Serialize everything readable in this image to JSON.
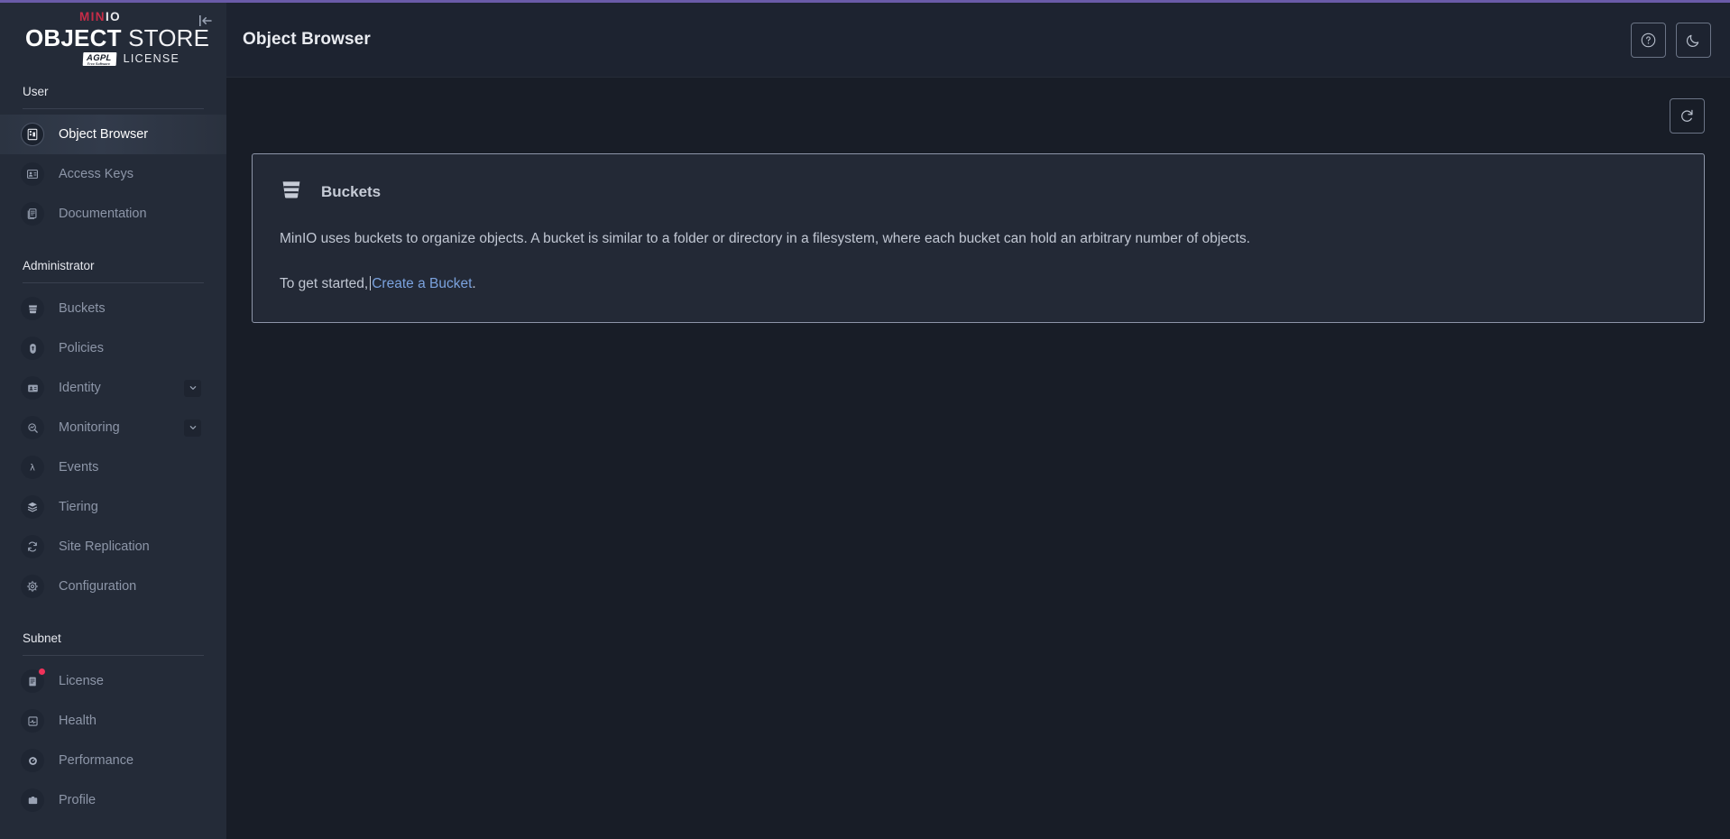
{
  "brand": {
    "name_top": "MIN",
    "name_top_io": "IO",
    "product_bold": "OBJECT",
    "product_light": "STORE",
    "agpl": "AGPL",
    "agpl_sub": "Free Software",
    "license_word": "LICENSE",
    "accent_color": "#c72c48",
    "top_accent_color": "#6a5ba8"
  },
  "sidebar": {
    "collapse_icon": "collapse-sidebar-icon",
    "sections": [
      {
        "title": "User",
        "items": [
          {
            "label": "Object Browser",
            "icon": "object-browser-icon",
            "active": true,
            "chevron": false,
            "badge": false
          },
          {
            "label": "Access Keys",
            "icon": "access-keys-icon",
            "active": false,
            "chevron": false,
            "badge": false
          },
          {
            "label": "Documentation",
            "icon": "documentation-icon",
            "active": false,
            "chevron": false,
            "badge": false
          }
        ]
      },
      {
        "title": "Administrator",
        "items": [
          {
            "label": "Buckets",
            "icon": "bucket-icon",
            "active": false,
            "chevron": false,
            "badge": false
          },
          {
            "label": "Policies",
            "icon": "policy-lock-icon",
            "active": false,
            "chevron": false,
            "badge": false
          },
          {
            "label": "Identity",
            "icon": "identity-card-icon",
            "active": false,
            "chevron": true,
            "badge": false
          },
          {
            "label": "Monitoring",
            "icon": "monitoring-icon",
            "active": false,
            "chevron": true,
            "badge": false
          },
          {
            "label": "Events",
            "icon": "lambda-events-icon",
            "active": false,
            "chevron": false,
            "badge": false
          },
          {
            "label": "Tiering",
            "icon": "tiering-layers-icon",
            "active": false,
            "chevron": false,
            "badge": false
          },
          {
            "label": "Site Replication",
            "icon": "site-replication-icon",
            "active": false,
            "chevron": false,
            "badge": false
          },
          {
            "label": "Configuration",
            "icon": "gear-icon",
            "active": false,
            "chevron": false,
            "badge": false
          }
        ]
      },
      {
        "title": "Subnet",
        "items": [
          {
            "label": "License",
            "icon": "license-icon",
            "active": false,
            "chevron": false,
            "badge": true
          },
          {
            "label": "Health",
            "icon": "health-icon",
            "active": false,
            "chevron": false,
            "badge": false
          },
          {
            "label": "Performance",
            "icon": "performance-icon",
            "active": false,
            "chevron": false,
            "badge": false
          },
          {
            "label": "Profile",
            "icon": "profile-icon",
            "active": false,
            "chevron": false,
            "badge": false
          }
        ]
      }
    ]
  },
  "header": {
    "title": "Object Browser",
    "help_button": "help-icon",
    "theme_button": "dark-mode-moon-icon"
  },
  "toolbar": {
    "refresh_button": "refresh-icon"
  },
  "card": {
    "icon": "bucket-icon",
    "title": "Buckets",
    "description": "MinIO uses buckets to organize objects. A bucket is similar to a folder or directory in a filesystem, where each bucket can hold an arbitrary number of objects.",
    "cta_prefix": "To get started,",
    "cta_link": "Create a Bucket",
    "cta_suffix": ".",
    "link_color": "#7ba2de"
  }
}
